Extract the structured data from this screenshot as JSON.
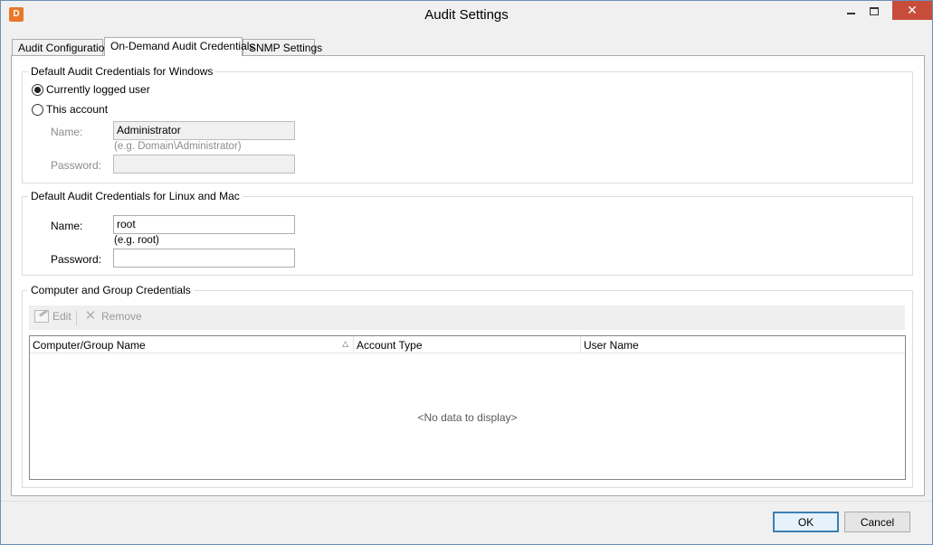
{
  "window": {
    "title": "Audit Settings",
    "app_icon": "D",
    "controls": {
      "minimize": "minimize-icon",
      "maximize": "maximize-icon",
      "close": "✕"
    }
  },
  "tabs": [
    {
      "label": "Audit Configuration",
      "active": false
    },
    {
      "label": "On-Demand Audit Credentials",
      "active": true
    },
    {
      "label": "SNMP Settings",
      "active": false
    }
  ],
  "windows_group": {
    "legend": "Default Audit Credentials for Windows",
    "radio_current": "Currently logged user",
    "radio_account": "This account",
    "selected": "Currently logged user",
    "name_label": "Name:",
    "name_value": "Administrator",
    "name_hint": "(e.g. Domain\\Administrator)",
    "password_label": "Password:",
    "password_value": ""
  },
  "linux_group": {
    "legend": "Default Audit Credentials for Linux and Mac",
    "name_label": "Name:",
    "name_value": "root",
    "name_hint": "(e.g. root)",
    "password_label": "Password:",
    "password_value": ""
  },
  "computer_group": {
    "legend": "Computer and Group Credentials",
    "toolbar": {
      "edit": "Edit",
      "remove": "Remove"
    },
    "columns": [
      "Computer/Group Name",
      "Account Type",
      "User Name"
    ],
    "sort_indicator": "△",
    "empty_message": "<No data to display>"
  },
  "footer": {
    "ok": "OK",
    "cancel": "Cancel"
  },
  "colors": {
    "close_button": "#c74c3c",
    "default_button_border": "#3c7fb1"
  }
}
